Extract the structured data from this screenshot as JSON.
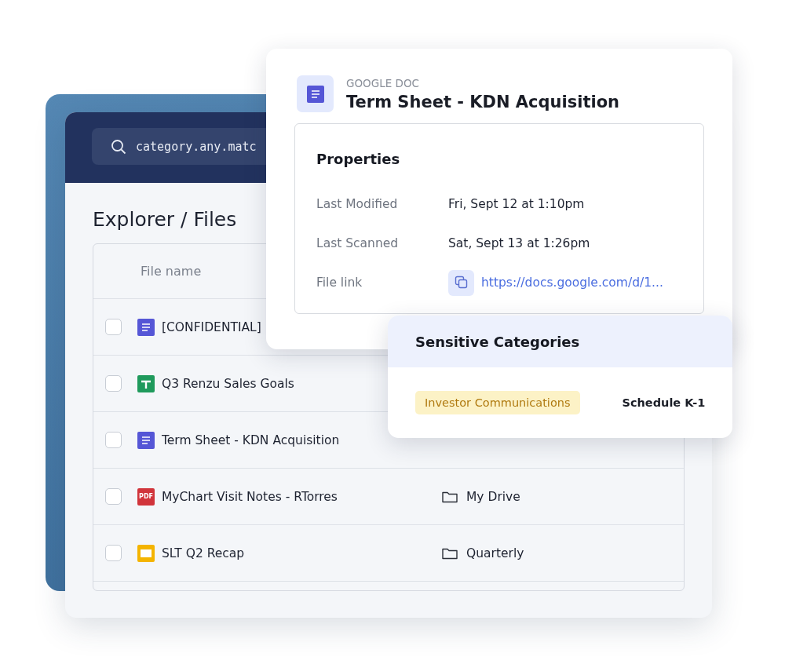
{
  "search": {
    "value": "category.any.matc"
  },
  "breadcrumb": "Explorer / Files",
  "table": {
    "columns": [
      "File name"
    ],
    "rows": [
      {
        "kind": "doc",
        "name": "[CONFIDENTIAL]",
        "checked": false
      },
      {
        "kind": "sheet",
        "name": "Q3 Renzu Sales Goals",
        "checked": false
      },
      {
        "kind": "doc",
        "name": "Term Sheet - KDN Acquisition",
        "checked": false
      },
      {
        "kind": "pdf",
        "icon_label": "PDF",
        "name": "MyChart Visit Notes - RTorres",
        "checked": false,
        "folder": "My Drive"
      },
      {
        "kind": "slides",
        "name": "SLT Q2 Recap",
        "checked": false,
        "folder": "Quarterly"
      }
    ]
  },
  "details": {
    "kind": "doc",
    "kind_label": "GOOGLE DOC",
    "title": "Term Sheet - KDN Acquisition",
    "properties_title": "Properties",
    "properties": [
      {
        "label": "Last Modified",
        "value": "Fri, Sept 12 at 1:10pm"
      },
      {
        "label": "Last Scanned",
        "value": "Sat, Sept 13 at 1:26pm"
      },
      {
        "label": "File link",
        "value": "https://docs.google.com/d/1...",
        "kind": "link"
      }
    ]
  },
  "sensitive": {
    "title": "Sensitive Categories",
    "tags": [
      {
        "label": "Investor Communications",
        "kind": "highlight"
      },
      {
        "label": "Schedule K-1",
        "kind": "plain"
      }
    ]
  }
}
